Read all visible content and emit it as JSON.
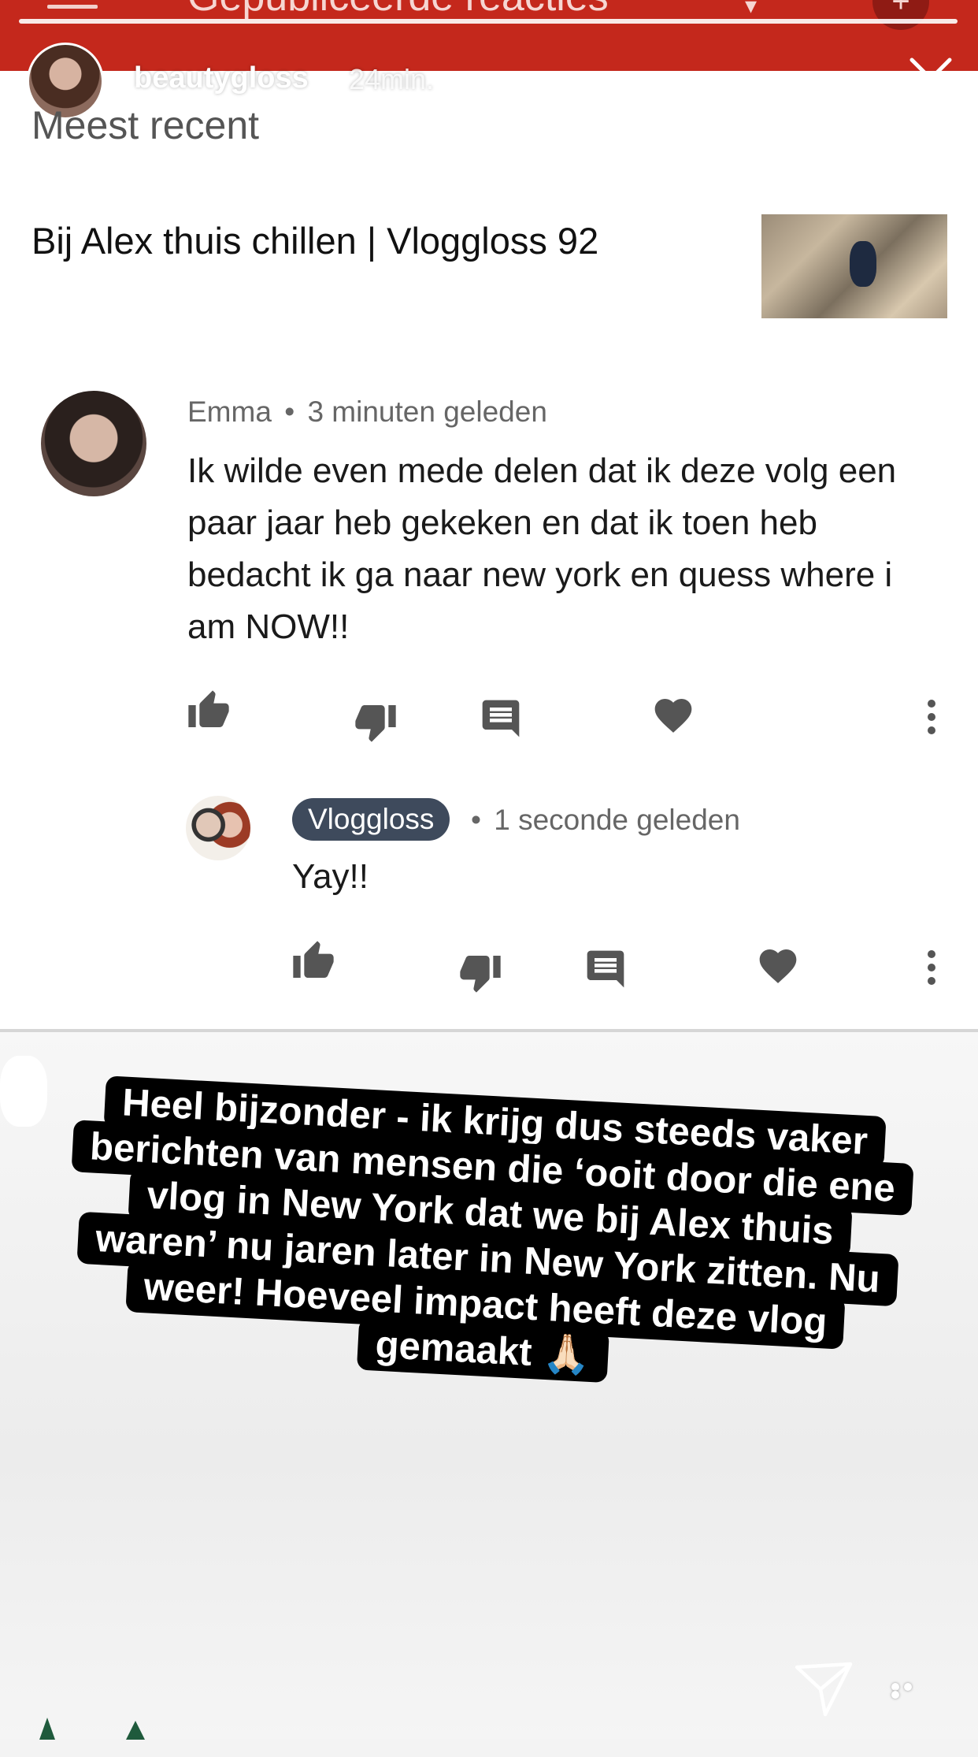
{
  "youtube_header": {
    "title": "Gepubliceerde reacties",
    "caret": "▾",
    "add_button": "+"
  },
  "story": {
    "username": "beautygloss",
    "time_ago": "24min."
  },
  "comments_page": {
    "sort_label": "Meest recent",
    "video_title": "Bij Alex thuis chillen | Vloggloss 92"
  },
  "comment": {
    "author": "Emma",
    "separator": "•",
    "time": "3 minuten geleden",
    "text": "Ik wilde even mede delen dat ik deze  volg een paar jaar heb gekeken en dat ik toen heb bedacht ik ga naar new york en quess where i am NOW!!"
  },
  "reply": {
    "author": "Vloggloss",
    "separator": "•",
    "time": "1 seconde geleden",
    "text": "Yay!!"
  },
  "caption": {
    "lines": [
      "Heel bijzonder - ik krijg dus steeds vaker",
      "berichten van mensen die ‘ooit door die ene",
      "vlog in New York dat we bij Alex thuis",
      "waren’ nu jaren later in New York zitten. Nu",
      "weer! Hoeveel impact heeft deze vlog",
      "gemaakt 🙏🏻"
    ]
  },
  "colors": {
    "header_red": "#c4281c",
    "badge": "#3e4a5c",
    "caption_bg": "#000000"
  },
  "icons": [
    "close-icon",
    "like-icon",
    "dislike-icon",
    "reply-icon",
    "heart-icon",
    "more-vert-icon",
    "send-icon",
    "more-horiz-icon"
  ]
}
